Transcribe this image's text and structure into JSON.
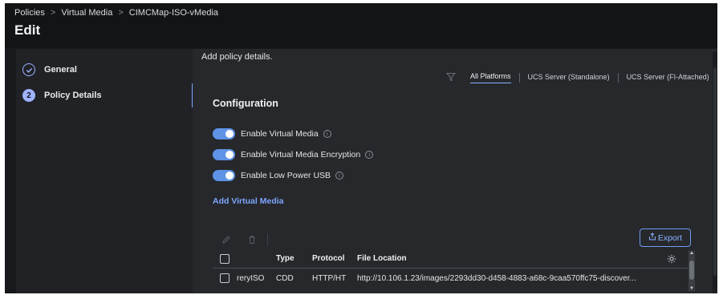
{
  "breadcrumb": {
    "items": [
      "Policies",
      "Virtual Media",
      "CIMCMap-ISO-vMedia"
    ],
    "separator": ">"
  },
  "page": {
    "title": "Edit"
  },
  "steps": [
    {
      "label": "General",
      "status": "complete",
      "icon": "check-circle-icon"
    },
    {
      "number": "2",
      "label": "Policy Details",
      "status": "active"
    }
  ],
  "main": {
    "subtitle": "Add policy details.",
    "platforms": {
      "tabs": [
        "All Platforms",
        "UCS Server (Standalone)",
        "UCS Server (FI-Attached)"
      ],
      "active": "All Platforms"
    },
    "configuration": {
      "title": "Configuration",
      "toggles": [
        {
          "label": "Enable Virtual Media",
          "on": true
        },
        {
          "label": "Enable Virtual Media Encryption",
          "on": true
        },
        {
          "label": "Enable Low Power USB",
          "on": true
        }
      ]
    },
    "add_link": "Add Virtual Media",
    "toolbar": {
      "edit_icon": "pencil-icon",
      "delete_icon": "trash-icon",
      "export_label": "Export"
    },
    "table": {
      "columns": [
        "",
        "Type",
        "Protocol",
        "File Location"
      ],
      "rows": [
        {
          "name": "reryISO",
          "type": "CDD",
          "protocol": "HTTP/HT",
          "location": "http://10.106.1.23/images/2293dd30-d458-4883-a68c-9caa570ffc75-discover..."
        }
      ]
    }
  },
  "colors": {
    "accent": "#7ea6ff",
    "toggle": "#5e93e6",
    "background": "#26282c"
  }
}
